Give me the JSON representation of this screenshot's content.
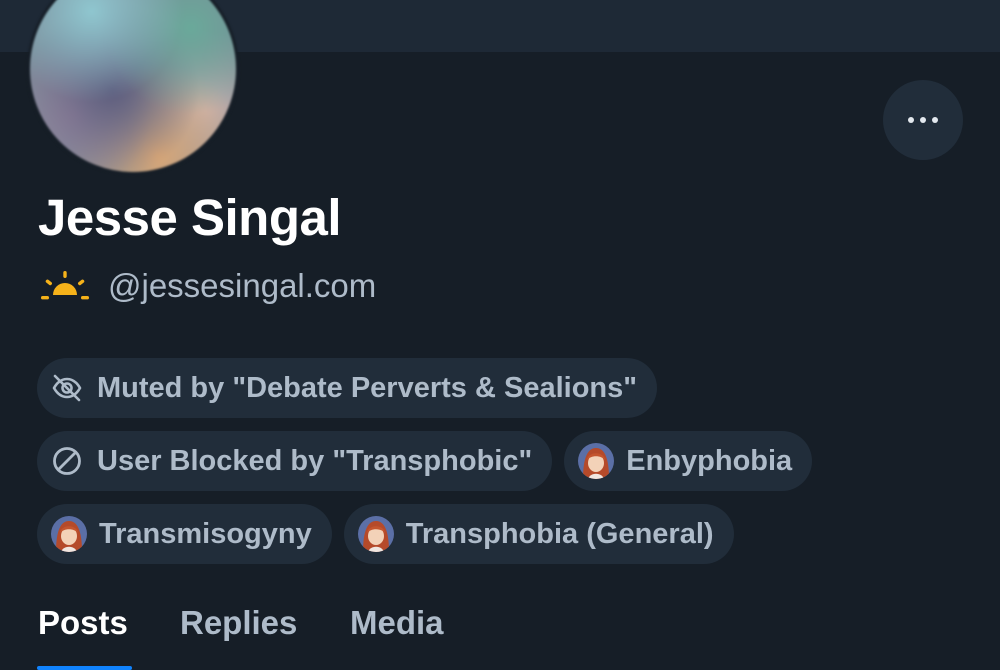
{
  "profile": {
    "display_name": "Jesse Singal",
    "handle": "@jessesingal.com",
    "handle_icon": "sunrise-icon"
  },
  "more_button": {
    "icon": "ellipsis-icon"
  },
  "labels": [
    {
      "text": "Muted by \"Debate Perverts & Sealions\"",
      "icon": "eye-slash-icon"
    },
    {
      "text": "User Blocked by \"Transphobic\"",
      "icon": "block-icon"
    },
    {
      "text": "Enbyphobia",
      "icon": "labeler-avatar"
    },
    {
      "text": "Transmisogyny",
      "icon": "labeler-avatar"
    },
    {
      "text": "Transphobia (General)",
      "icon": "labeler-avatar"
    }
  ],
  "tabs": [
    {
      "label": "Posts",
      "active": true
    },
    {
      "label": "Replies",
      "active": false
    },
    {
      "label": "Media",
      "active": false
    }
  ],
  "colors": {
    "background": "#161e27",
    "surface": "#212d3a",
    "text_secondary": "#aebbc9",
    "accent": "#1083fe",
    "sun": "#f5b21a"
  }
}
